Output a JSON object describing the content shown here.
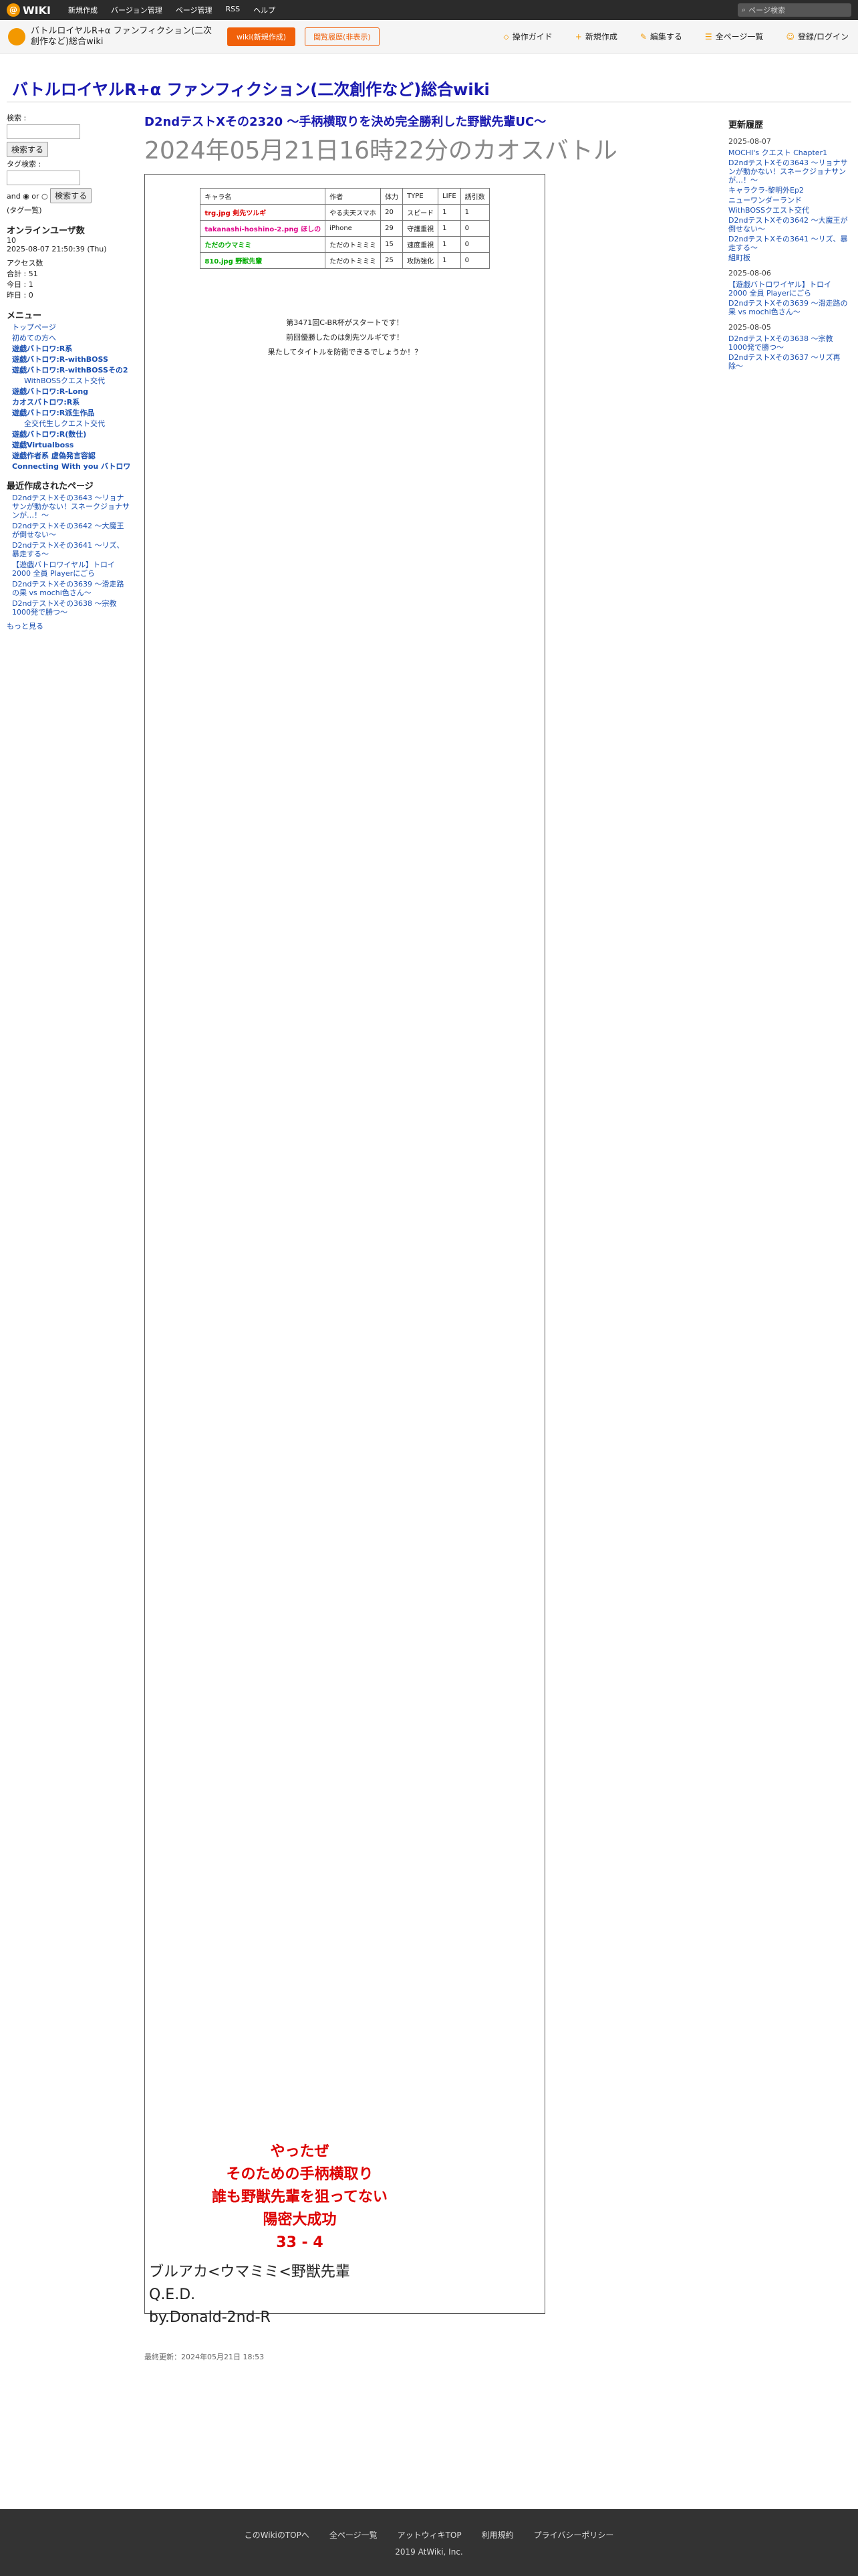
{
  "header": {
    "logo": "WIKI",
    "nav": [
      "新規作成",
      "バージョン管理",
      "ページ管理",
      "RSS",
      "ヘルプ"
    ],
    "search_placeholder": "ページ検索"
  },
  "subbar": {
    "wiki_title": "バトルロイヤルR+α ファンフィクション(二次創作など)総合wiki",
    "btn_new": "wiki(新規作成)",
    "btn_hist": "閲覧履歴(非表示)",
    "actions": [
      "操作ガイド",
      "新規作成",
      "編集する",
      "全ページ一覧",
      "登録/ログイン"
    ]
  },
  "site_title": "バトルロイヤルR+α ファンフィクション(二次創作など)総合wiki",
  "left": {
    "search_label": "検索 :",
    "search_btn": "検索する",
    "tag_label": "タグ検索 :",
    "and": "and",
    "or": "or",
    "search_btn2": "検索する",
    "tag_note": "(タグ一覧)",
    "online": "オンラインユーザ数",
    "online_count": "10",
    "online_time": "2025-08-07 21:50:39 (Thu)",
    "access": "アクセス数",
    "access_total": "合計 : 51",
    "access_today": "今日 : 1",
    "access_yesterday": "昨日 : 0",
    "menu_title": "メニュー",
    "menu": [
      "トップページ",
      "初めての方へ",
      "遊戯バトロワ:R系",
      "遊戯バトロワ:R-withBOSS",
      "遊戯バトロワ:R-withBOSSその2",
      "WithBOSSクエスト交代",
      "遊戯バトロワ:R-Long",
      "カオスバトロワ:R系",
      "遊戯バトロワ:R派生作品",
      "全交代生しクエスト交代",
      "遊戯バトロワ:R(数仕)",
      "遊戯Virtualboss",
      "遊戯作者系 虚偽発言容認",
      "Connecting With you バトロワ"
    ],
    "recent_title": "最近作成されたページ",
    "recent": [
      "D2ndテストXその3643 〜リョナサンが動かない！スネークジョナサンが…！〜",
      "D2ndテストXその3642 〜大魔王が倒せない〜",
      "D2ndテストXその3641 〜リズ、暴走する〜",
      "【遊戯バトロワイヤル】トロイ2000 全員 Playerにごら",
      "D2ndテストXその3639 〜滑走路の果 vs mochi色さん〜",
      "D2ndテストXその3638 〜宗教1000発で勝つ〜"
    ],
    "more": "もっと見る"
  },
  "article": {
    "title": "D2ndテストXその2320 〜手柄横取りを決め完全勝利した野獣先輩UC〜",
    "date": "2024年05月21日16時22分のカオスバトル",
    "table_head": [
      "キャラ名",
      "作者",
      "体力",
      "TYPE",
      "LIFE",
      "誘引数"
    ],
    "table_rows": [
      [
        "trg.jpg 剣先ツルギ",
        "やる夫天スマホ",
        "20",
        "スピード",
        "1",
        "1"
      ],
      [
        "takanashi-hoshino-2.png ほしの",
        "iPhone",
        "29",
        "守護重視",
        "1",
        "0"
      ],
      [
        "ただのウマミミ",
        "ただのトミミミ",
        "15",
        "速度重視",
        "1",
        "0"
      ],
      [
        "810.jpg 野獣先輩",
        "ただのトミミミ",
        "25",
        "攻防強化",
        "1",
        "0"
      ]
    ],
    "start": "第3471回C-BR杯がスタートです！",
    "prev_winner": "前回優勝したのは剣先ツルギです！",
    "question": "果たしてタイトルを防衛できるでしょうか！？",
    "final_line": "ブルアカ<ウマミミ<野獣先輩",
    "qed": "Q.E.D.",
    "by": "by.Donald-2nd-R",
    "big1": "やったぜ",
    "big2": "そのための手柄横取り",
    "big3": "誰も野獣先輩を狙ってない",
    "big4": "陽密大成功",
    "big5": "33 - 4",
    "footer_note": "最終更新：2024年05月21日 18:53"
  },
  "right": {
    "title": "更新履歴",
    "groups": [
      {
        "date": "2025-08-07",
        "items": [
          "MOCHI's クエスト Chapter1",
          "D2ndテストXその3643 〜リョナサンが動かない！スネークジョナサンが…！〜",
          "キャラクラ-黎明外Ep2",
          "ニューワンダーランド",
          "WithBOSSクエスト交代",
          "D2ndテストXその3642 〜大魔王が倒せない〜",
          "D2ndテストXその3641 〜リズ、暴走する〜",
          "組町板"
        ]
      },
      {
        "date": "2025-08-06",
        "items": [
          "【遊戯バトロワイヤル】トロイ2000 全員 Playerにごら",
          "D2ndテストXその3639 〜滑走路の果 vs mochi色さん〜"
        ]
      },
      {
        "date": "2025-08-05",
        "items": [
          "D2ndテストXその3638 〜宗教1000発で勝つ〜",
          "D2ndテストXその3637 〜リズ再除〜"
        ]
      }
    ]
  },
  "footer": {
    "links": [
      "このWikiのTOPへ",
      "全ページ一覧",
      "アットウィキTOP",
      "利用規約",
      "プライバシーポリシー"
    ],
    "copy": "2019 AtWiki, Inc."
  }
}
